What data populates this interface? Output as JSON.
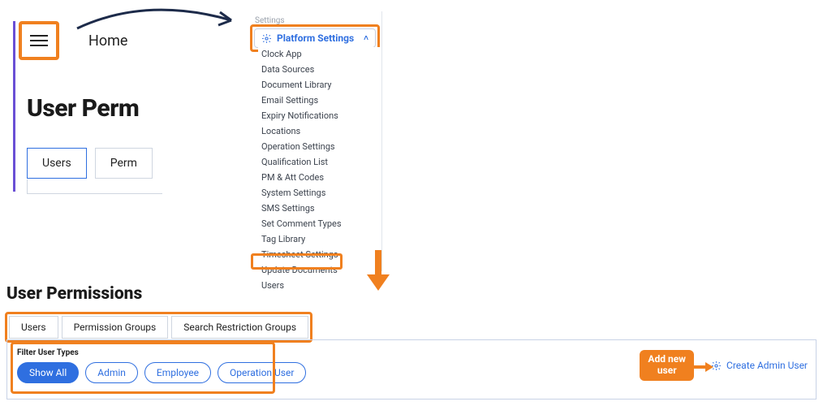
{
  "header": {
    "home_label": "Home",
    "big_title": "User Perm"
  },
  "mini_tabs": {
    "tab0": "Users",
    "tab1": "Perm"
  },
  "settings_section_label": "Settings",
  "dropdown": {
    "label": "Platform Settings"
  },
  "settings_items": {
    "i0": "Clock App",
    "i1": "Data Sources",
    "i2": "Document Library",
    "i3": "Email Settings",
    "i4": "Expiry Notifications",
    "i5": "Locations",
    "i6": "Operation Settings",
    "i7": "Qualification List",
    "i8": "PM & Att Codes",
    "i9": "System Settings",
    "i10": "SMS Settings",
    "i11": "Set Comment Types",
    "i12": "Tag Library",
    "i13": "Timesheet Settings",
    "i14": "Update Documents",
    "i15": "Users"
  },
  "bottom": {
    "title": "User Permissions",
    "tab_users": "Users",
    "tab_perm_groups": "Permission Groups",
    "tab_search_restrict": "Search Restriction Groups",
    "filter_label": "Filter User Types",
    "pill_all": "Show All",
    "pill_admin": "Admin",
    "pill_employee": "Employee",
    "pill_operation": "Operation User",
    "callout_l1": "Add new",
    "callout_l2": "user",
    "create_link": "Create Admin User"
  },
  "colors": {
    "accent_blue": "#2f6fe0",
    "highlight_orange": "#f0801f"
  }
}
